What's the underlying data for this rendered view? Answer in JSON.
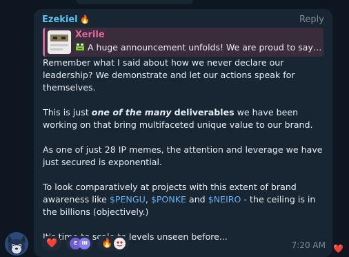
{
  "message": {
    "sender_name": "Ezekiel",
    "sender_emoji": "🔥",
    "reply_label": "Reply",
    "quote": {
      "name": "Xerile",
      "text": "A huge announcement unfolds! We are proud to say t..."
    },
    "para1": "Remember what I said about how we never declare our leadership? We demonstrate and let our actions speak for themselves.",
    "para2": {
      "t1": "This is just ",
      "em1": "one of the many",
      "t2": " ",
      "b1": "deliverables",
      "t3": " we have been working on that bring multifaceted unique value to our brand."
    },
    "para3": "As one of just 28 IP memes, the attention and leverage we have just secured is exponential.",
    "para4": {
      "t1": "To look comparatively at projects with this extent of brand awareness like ",
      "c1": "$PENGU",
      "s1": ", ",
      "c2": "$PONKE",
      "s2": " and ",
      "c3": "$NEIRO",
      "t2": " - the ceiling is in the billions (objectively.)"
    },
    "para5": "It's time to scale to levels unseen before...",
    "time": "7:20 AM"
  },
  "reactions": [
    {
      "emoji": "❤️",
      "icon": "heart-icon"
    },
    {
      "emoji": "",
      "icon": "reactor-avatars"
    },
    {
      "emoji": "🔥",
      "icon": "fire-icon"
    }
  ],
  "reactor_initials": [
    "E",
    "IN"
  ],
  "side_reaction": "❤️",
  "colors": {
    "background": "#0e1621",
    "bubble": "#182533",
    "sender": "#5bc2ee",
    "quote_accent": "#d3679b",
    "link": "#6ab2f2"
  }
}
